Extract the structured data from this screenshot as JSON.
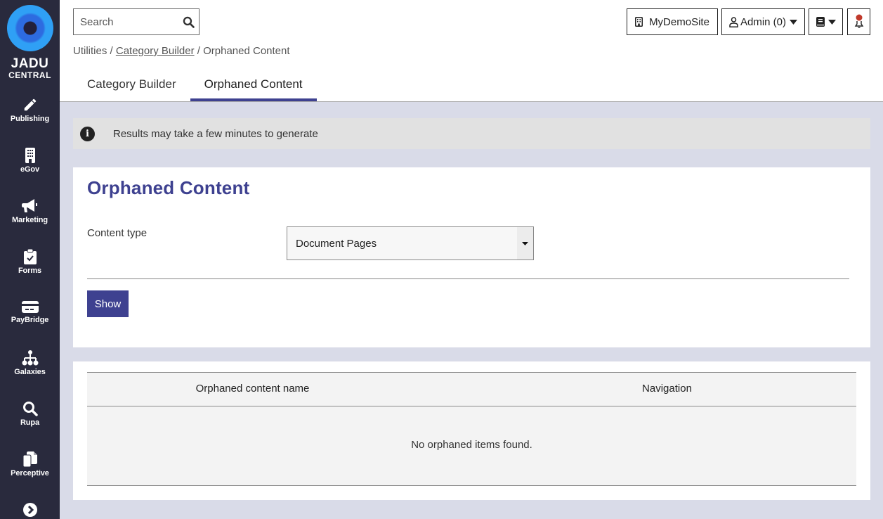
{
  "sidebar": {
    "logo": {
      "line1": "JADU",
      "line2": "CENTRAL"
    },
    "items": [
      {
        "label": "Publishing",
        "icon": "pencil-icon"
      },
      {
        "label": "eGov",
        "icon": "building-icon"
      },
      {
        "label": "Marketing",
        "icon": "megaphone-icon"
      },
      {
        "label": "Forms",
        "icon": "clipboard-check-icon"
      },
      {
        "label": "PayBridge",
        "icon": "credit-card-icon"
      },
      {
        "label": "Galaxies",
        "icon": "sitemap-icon"
      },
      {
        "label": "Rupa",
        "icon": "search-icon"
      },
      {
        "label": "Perceptive",
        "icon": "copy-icon"
      }
    ],
    "expand_icon": "chevron-right-circle-icon"
  },
  "header": {
    "search": {
      "placeholder": "Search",
      "value": ""
    },
    "site_button": "MyDemoSite",
    "user_button": "Admin (0)",
    "breadcrumb": {
      "items": [
        {
          "label": "Utilities",
          "link": false
        },
        {
          "label": "Category Builder",
          "link": true
        },
        {
          "label": "Orphaned Content",
          "link": false
        }
      ],
      "separator": "/"
    },
    "tabs": [
      {
        "label": "Category Builder",
        "active": false
      },
      {
        "label": "Orphaned Content",
        "active": true
      }
    ],
    "notification_dot_color": "#c0392b"
  },
  "info_banner": {
    "text": "Results may take a few minutes to generate"
  },
  "form": {
    "title": "Orphaned Content",
    "content_type_label": "Content type",
    "content_type_value": "Document Pages",
    "show_button": "Show"
  },
  "results": {
    "columns": [
      "Orphaned content name",
      "Navigation"
    ],
    "empty_message": "No orphaned items found."
  },
  "colors": {
    "accent": "#3e4190",
    "sidebar_bg": "#292a3d",
    "page_bg": "#d9dbe8"
  }
}
